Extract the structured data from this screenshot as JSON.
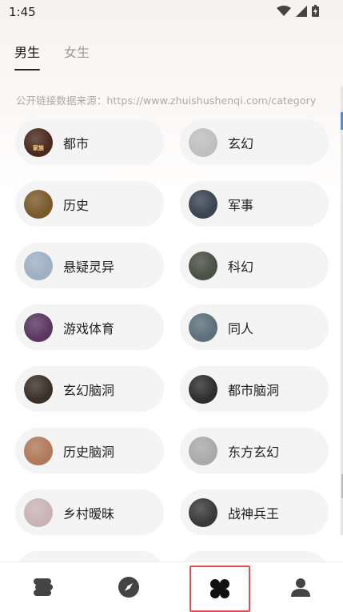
{
  "status_bar": {
    "time": "1:45"
  },
  "tabs": [
    {
      "label": "男生",
      "active": true
    },
    {
      "label": "女生",
      "active": false
    }
  ],
  "source_text": "公开链接数据来源：https://www.zhuishushenqi.com/category",
  "categories": [
    {
      "label": "都市",
      "thumb_color": "#4a2a1e",
      "thumb_text": "家族"
    },
    {
      "label": "玄幻",
      "thumb_color": "#bfbfbf",
      "thumb_text": ""
    },
    {
      "label": "历史",
      "thumb_color": "#7a5a2a",
      "thumb_text": ""
    },
    {
      "label": "军事",
      "thumb_color": "#3a4452",
      "thumb_text": ""
    },
    {
      "label": "悬疑灵异",
      "thumb_color": "#9fb0c4",
      "thumb_text": ""
    },
    {
      "label": "科幻",
      "thumb_color": "#4b4f45",
      "thumb_text": ""
    },
    {
      "label": "游戏体育",
      "thumb_color": "#5a3760",
      "thumb_text": ""
    },
    {
      "label": "同人",
      "thumb_color": "#5d6f79",
      "thumb_text": ""
    },
    {
      "label": "玄幻脑洞",
      "thumb_color": "#3a3028",
      "thumb_text": ""
    },
    {
      "label": "都市脑洞",
      "thumb_color": "#2e2e2e",
      "thumb_text": ""
    },
    {
      "label": "历史脑洞",
      "thumb_color": "#b07a5a",
      "thumb_text": ""
    },
    {
      "label": "东方玄幻",
      "thumb_color": "#aaaaaa",
      "thumb_text": ""
    },
    {
      "label": "乡村暧昧",
      "thumb_color": "#c9b3b8",
      "thumb_text": ""
    },
    {
      "label": "战神兵王",
      "thumb_color": "#3a3a3a",
      "thumb_text": ""
    }
  ],
  "bottom_nav": [
    {
      "icon": "bookshelf-icon",
      "selected": false
    },
    {
      "icon": "compass-icon",
      "selected": false
    },
    {
      "icon": "category-clover-icon",
      "selected": true
    },
    {
      "icon": "profile-icon",
      "selected": false
    }
  ],
  "colors": {
    "accent": "#222222",
    "highlight_box": "#d9534f",
    "pill_bg": "#f4f4f4"
  }
}
